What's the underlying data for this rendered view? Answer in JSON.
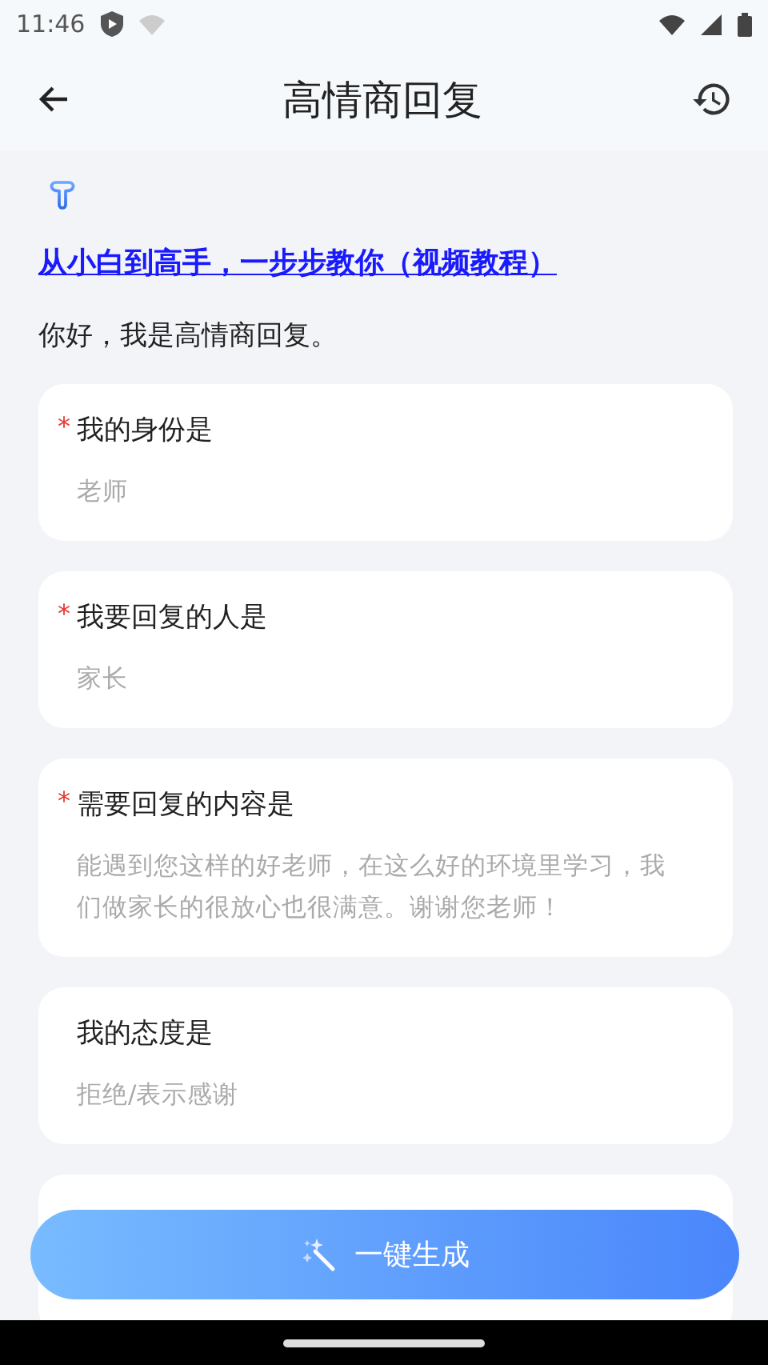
{
  "status_bar": {
    "time": "11:46"
  },
  "header": {
    "title": "高情商回复"
  },
  "tutorial_link": "从小白到高手，一步步教你（视频教程）",
  "greeting": "你好，我是高情商回复。",
  "fields": [
    {
      "label": "我的身份是",
      "required_mark": "*",
      "placeholder": "老师"
    },
    {
      "label": "我要回复的人是",
      "required_mark": "*",
      "placeholder": "家长"
    },
    {
      "label": "需要回复的内容是",
      "required_mark": "*",
      "placeholder": "能遇到您这样的好老师，在这么好的环境里学习，我们做家长的很放心也很满意。谢谢您老师！"
    },
    {
      "label": "我的态度是",
      "placeholder": "拒绝/表示感谢"
    }
  ],
  "generate_button": {
    "label": "一键生成"
  }
}
